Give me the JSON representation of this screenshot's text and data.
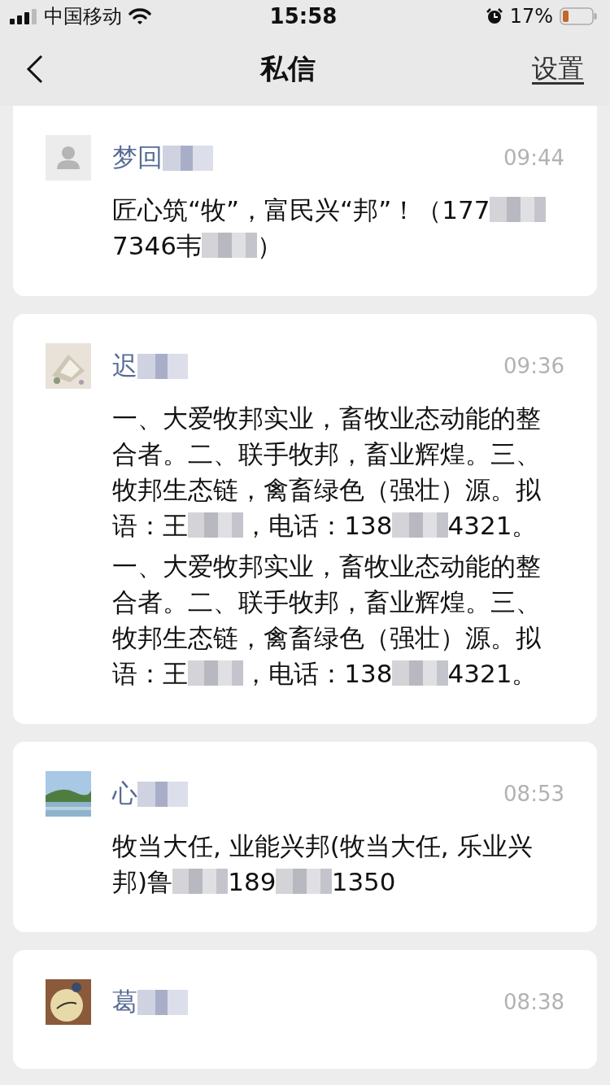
{
  "status_bar": {
    "carrier": "中国移动",
    "time": "15:58",
    "battery": "17%"
  },
  "nav": {
    "title": "私信",
    "action": "设置"
  },
  "messages": [
    {
      "avatar": {
        "kind": "default"
      },
      "name": [
        {
          "kind": "text",
          "text": "梦回"
        },
        {
          "kind": "blur"
        }
      ],
      "time": "09:44",
      "paragraphs": [
        [
          {
            "kind": "text",
            "text": "匠心筑“牧”，富民兴“邦”！（177"
          },
          {
            "kind": "blur"
          },
          {
            "kind": "text",
            "text": "7346韦"
          },
          {
            "kind": "blur"
          },
          {
            "kind": "text",
            "text": "）"
          }
        ]
      ]
    },
    {
      "avatar": {
        "kind": "picture"
      },
      "name": [
        {
          "kind": "text",
          "text": "迟"
        },
        {
          "kind": "blur"
        }
      ],
      "time": "09:36",
      "paragraphs": [
        [
          {
            "kind": "text",
            "text": "一、大爱牧邦实业，畜牧业态动能的整合者。二、联手牧邦，畜业辉煌。三、牧邦生态链，禽畜绿色（强壮）源。拟语：王"
          },
          {
            "kind": "blur"
          },
          {
            "kind": "text",
            "text": "，电话：138"
          },
          {
            "kind": "blur"
          },
          {
            "kind": "text",
            "text": "4321。"
          }
        ],
        [
          {
            "kind": "text",
            "text": "一、大爱牧邦实业，畜牧业态动能的整合者。二、联手牧邦，畜业辉煌。三、牧邦生态链，禽畜绿色（强壮）源。拟语：王"
          },
          {
            "kind": "blur"
          },
          {
            "kind": "text",
            "text": "，电话：138"
          },
          {
            "kind": "blur"
          },
          {
            "kind": "text",
            "text": "4321。"
          }
        ]
      ]
    },
    {
      "avatar": {
        "kind": "picture"
      },
      "name": [
        {
          "kind": "text",
          "text": "心"
        },
        {
          "kind": "blur"
        }
      ],
      "time": "08:53",
      "paragraphs": [
        [
          {
            "kind": "text",
            "text": "牧当大任, 业能兴邦(牧当大任, 乐业兴邦)鲁"
          },
          {
            "kind": "blur"
          },
          {
            "kind": "text",
            "text": "189"
          },
          {
            "kind": "blur"
          },
          {
            "kind": "text",
            "text": "1350"
          }
        ]
      ]
    },
    {
      "avatar": {
        "kind": "picture"
      },
      "name": [
        {
          "kind": "text",
          "text": "葛"
        },
        {
          "kind": "blur"
        }
      ],
      "time": "08:38"
    }
  ]
}
